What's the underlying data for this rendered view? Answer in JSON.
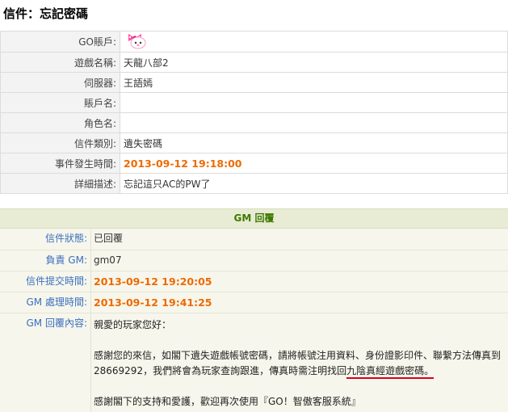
{
  "page_title": "信件：忘記密碼",
  "ticket": {
    "account_label": "GO賬戶:",
    "game_label": "遊戲名稱:",
    "game_value": "天龍八部2",
    "server_label": "伺服器:",
    "server_value": "王語嫣",
    "account_name_label": "賬戶名:",
    "account_name_value": "",
    "character_label": "角色名:",
    "character_value": "",
    "category_label": "信件類別:",
    "category_value": "遺失密碼",
    "event_time_label": "事件發生時間:",
    "event_time_value": "2013-09-12 19:18:00",
    "detail_label": "詳細描述:",
    "detail_value": "忘記這只AC的PW了"
  },
  "gm": {
    "header": "GM 回覆",
    "status_label": "信件狀態:",
    "status_value": "已回覆",
    "owner_label": "負責 GM:",
    "owner_value": "gm07",
    "submit_label": "信件提交時間:",
    "submit_value": "2013-09-12 19:20:05",
    "process_label": "GM 處理時間:",
    "process_value": "2013-09-12 19:41:25",
    "content_label": "GM 回覆內容:",
    "greeting": "親愛的玩家您好：",
    "body_line1": "感謝您的來信，如閣下遺失遊戲帳號密碼，請將帳號注用資料、身份證影印件、聯繫方法傳真到",
    "body_line2_prefix": "28669292，我們將會為玩家查詢跟進，傳真時需注明找回",
    "body_line2_highlight": "九陰真經遊戲密碼",
    "body_line2_suffix": "。",
    "closing": "感謝閣下的支持和愛護，歡迎再次使用『GO！智傲客服系統』"
  },
  "colors": {
    "time_orange": "#ee6a00",
    "gm_label_blue": "#3a6fbf",
    "gm_header_green": "#3d7a00",
    "underline_red": "#d9001b"
  },
  "icons": {
    "avatar": "pink-bow-avatar-icon"
  }
}
